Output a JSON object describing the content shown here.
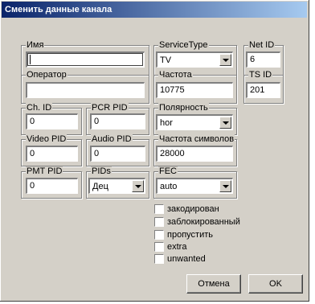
{
  "window": {
    "title": "Сменить данные канала"
  },
  "fields": {
    "name": {
      "label": "Имя",
      "value": ""
    },
    "service_type": {
      "label": "ServiceType",
      "value": "TV"
    },
    "net_id": {
      "label": "Net ID",
      "value": "6"
    },
    "operator": {
      "label": "Оператор",
      "value": ""
    },
    "frequency": {
      "label": "Частота",
      "value": "10775"
    },
    "ts_id": {
      "label": "TS ID",
      "value": "201"
    },
    "ch_id": {
      "label": "Ch. ID",
      "value": "0"
    },
    "pcr_pid": {
      "label": "PCR PID",
      "value": "0"
    },
    "polarity": {
      "label": "Полярность",
      "value": "hor"
    },
    "video_pid": {
      "label": "Video PID",
      "value": "0"
    },
    "audio_pid": {
      "label": "Audio PID",
      "value": "0"
    },
    "symbol_rate": {
      "label": "Частота символов",
      "value": "28000"
    },
    "pmt_pid": {
      "label": "PMT PID",
      "value": "0"
    },
    "pids": {
      "label": "PIDs",
      "value": "Дец"
    },
    "fec": {
      "label": "FEC",
      "value": "auto"
    }
  },
  "checkboxes": [
    {
      "label": "закодирован",
      "checked": false
    },
    {
      "label": "заблокированный",
      "checked": false
    },
    {
      "label": "пропустить",
      "checked": false
    },
    {
      "label": "extra",
      "checked": false
    },
    {
      "label": "unwanted",
      "checked": false
    }
  ],
  "buttons": {
    "cancel": "Отмена",
    "ok": "OK"
  }
}
